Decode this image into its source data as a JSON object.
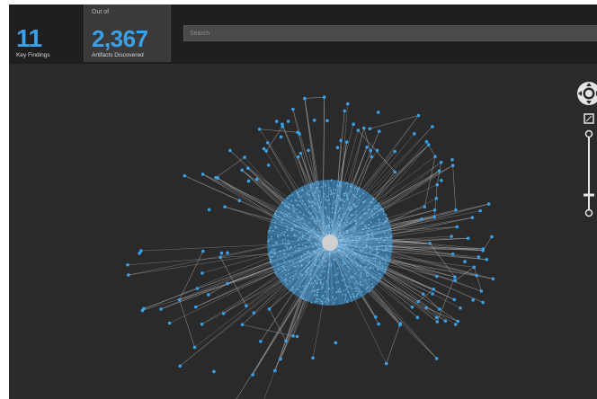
{
  "stats": {
    "findings_count": "11",
    "findings_label": "Key Findings",
    "artifacts_prefix": "Out of",
    "artifacts_count": "2,367",
    "artifacts_label": "Artifacts Discovered"
  },
  "search": {
    "placeholder": "Search"
  },
  "colors": {
    "accent": "#3aa0e8",
    "edge": "#bfbfbf",
    "background": "#2a2a2a"
  },
  "icons": {
    "pan": "pan-control-icon",
    "fit": "fit-to-screen-icon",
    "zoom_in": "zoom-in-icon",
    "zoom_out": "zoom-out-icon"
  }
}
